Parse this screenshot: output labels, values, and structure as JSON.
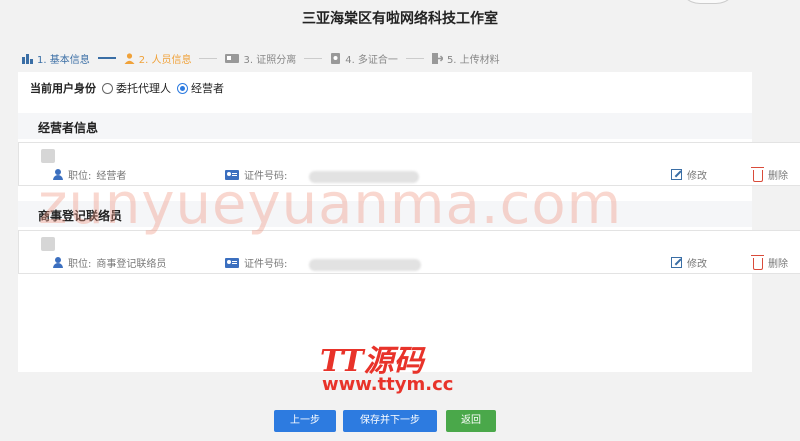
{
  "header": {
    "title": "三亚海棠区有啦网络科技工作室"
  },
  "steps": [
    {
      "label": "1. 基本信息",
      "icon": "chart-icon",
      "state": "done"
    },
    {
      "label": "2. 人员信息",
      "icon": "person-icon",
      "state": "active"
    },
    {
      "label": "3. 证照分离",
      "icon": "license-icon",
      "state": "pending"
    },
    {
      "label": "4. 多证合一",
      "icon": "certificate-icon",
      "state": "pending"
    },
    {
      "label": "5. 上传材料",
      "icon": "upload-icon",
      "state": "pending"
    }
  ],
  "identity": {
    "label": "当前用户身份",
    "options": [
      {
        "label": "委托代理人",
        "selected": false
      },
      {
        "label": "经营者",
        "selected": true
      }
    ]
  },
  "sections": [
    {
      "title": "经营者信息",
      "card": {
        "position_label": "职位:",
        "position_value": "经营者",
        "id_label": "证件号码:",
        "edit_label": "修改",
        "delete_label": "删除"
      }
    },
    {
      "title": "商事登记联络员",
      "card": {
        "position_label": "职位:",
        "position_value": "商事登记联络员",
        "id_label": "证件号码:",
        "edit_label": "修改",
        "delete_label": "删除"
      }
    }
  ],
  "watermarks": {
    "main": "zunyueyuanma.com",
    "logo": "TT源码",
    "logo_url": "www.ttym.cc"
  },
  "buttons": {
    "prev": "上一步",
    "save_next": "保存并下一步",
    "back": "返回"
  },
  "colors": {
    "primary": "#2d7be0",
    "success": "#4aa84a",
    "active_step": "#f0a23a",
    "danger": "#d94b3a"
  }
}
